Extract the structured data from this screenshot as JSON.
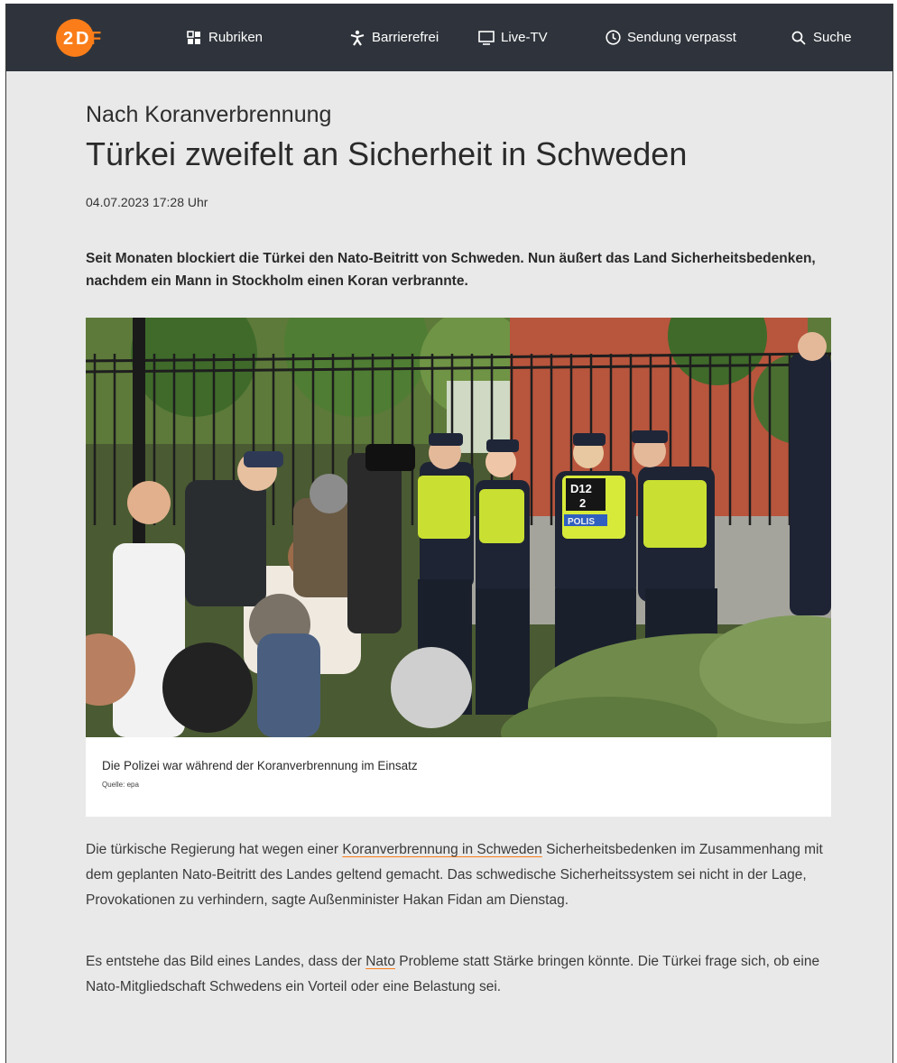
{
  "nav": {
    "logo_text": "ZDF",
    "items": [
      {
        "label": "Rubriken",
        "icon": "grid-icon"
      },
      {
        "label": "Barrierefrei",
        "icon": "accessibility-icon"
      },
      {
        "label": "Live-TV",
        "icon": "tv-icon"
      },
      {
        "label": "Sendung verpasst",
        "icon": "clock-icon"
      },
      {
        "label": "Suche",
        "icon": "search-icon"
      }
    ]
  },
  "article": {
    "kicker": "Nach Koranverbrennung",
    "headline": "Türkei zweifelt an Sicherheit in Schweden",
    "date": "04.07.2023 17:28 Uhr",
    "lead": "Seit Monaten blockiert die Türkei den Nato-Beitritt von Schweden. Nun äußert das Land Sicherheitsbedenken, nachdem ein Mann in Stockholm einen Koran verbrannte.",
    "image": {
      "vest_label": "D12 2 POLIS",
      "caption": "Die Polizei war während der Koranverbrennung im Einsatz",
      "source": "Quelle: epa"
    },
    "p1": {
      "before": "Die türkische Regierung hat wegen einer ",
      "link": "Koranverbrennung in Schweden",
      "after": " Sicherheitsbedenken im Zusammenhang mit dem geplanten Nato-Beitritt des Landes geltend gemacht. Das schwedische Sicherheitssystem sei nicht in der Lage, Provokationen zu verhindern, sagte Außenminister Hakan Fidan am Dienstag."
    },
    "p2": {
      "before": "Es entstehe das Bild eines Landes, dass der ",
      "link": "Nato",
      "after": " Probleme statt Stärke bringen könnte. Die Türkei frage sich, ob eine Nato-Mitgliedschaft Schwedens ein Vorteil oder eine Belastung sei."
    }
  },
  "colors": {
    "brand_orange": "#fa7d19",
    "navbar_bg": "#2f343c",
    "page_bg": "#e9e9e9"
  }
}
